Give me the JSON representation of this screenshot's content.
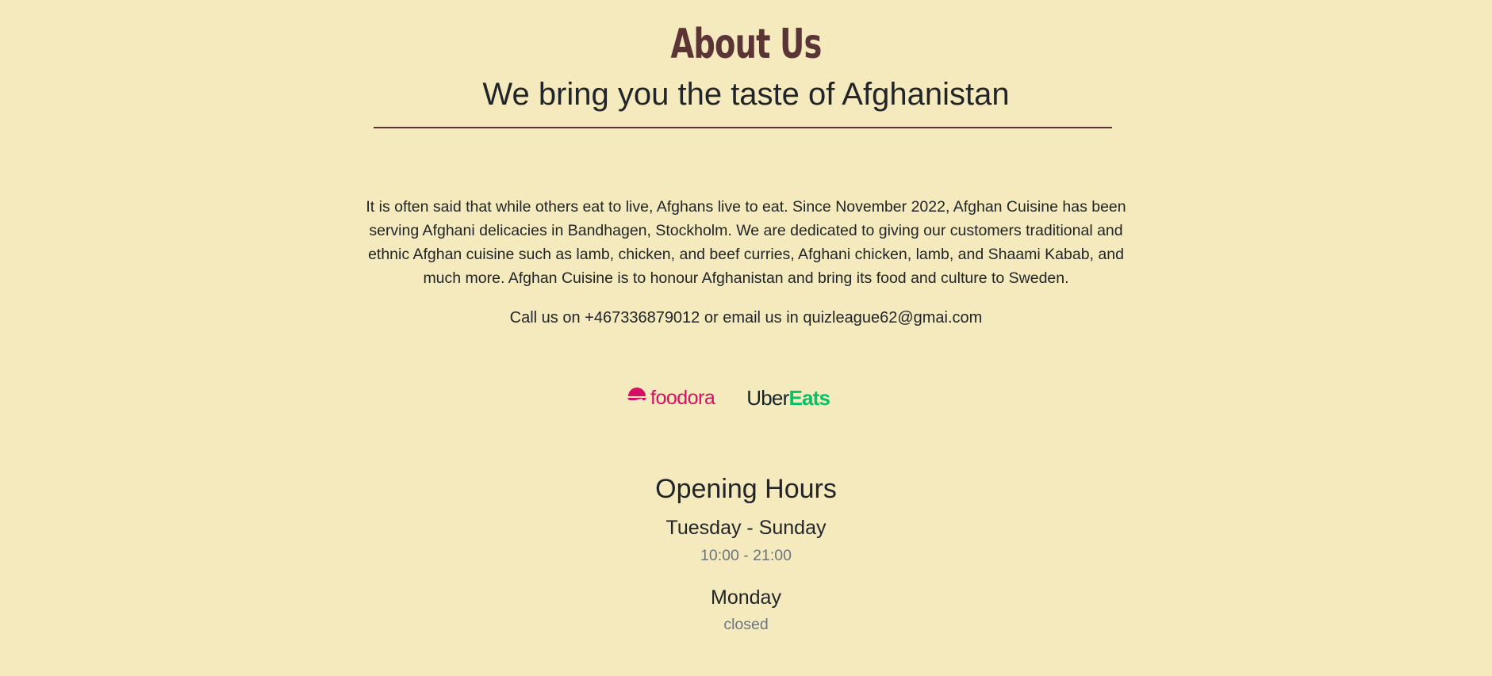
{
  "about": {
    "title": "About Us",
    "subtitle": "We bring you the taste of Afghanistan",
    "description": "It is often said that while others eat to live, Afghans live to eat. Since November 2022, Afghan Cuisine has been serving Afghani delicacies in Bandhagen, Stockholm. We are dedicated to giving our customers traditional and ethnic Afghan cuisine such as lamb, chicken, and beef curries, Afghani chicken, lamb, and Shaami Kabab, and much more. Afghan Cuisine is to honour Afghanistan and bring its food and culture to Sweden.",
    "contact": "Call us on +467336879012 or email us in quizleague62@gmai.com"
  },
  "delivery": {
    "foodora": {
      "label": "foodora",
      "icon": "foodora-logo-icon",
      "color": "#d70f64"
    },
    "ubereats": {
      "uber": "Uber",
      "eats": "Eats",
      "uber_color": "#142328",
      "eats_color": "#06c167"
    }
  },
  "hours": {
    "title": "Opening Hours",
    "entries": [
      {
        "days": "Tuesday - Sunday",
        "time": "10:00 - 21:00"
      },
      {
        "days": "Monday",
        "time": "closed"
      }
    ]
  },
  "colors": {
    "background": "#f4eabd",
    "title": "#5b3535",
    "muted": "#6c757d"
  }
}
